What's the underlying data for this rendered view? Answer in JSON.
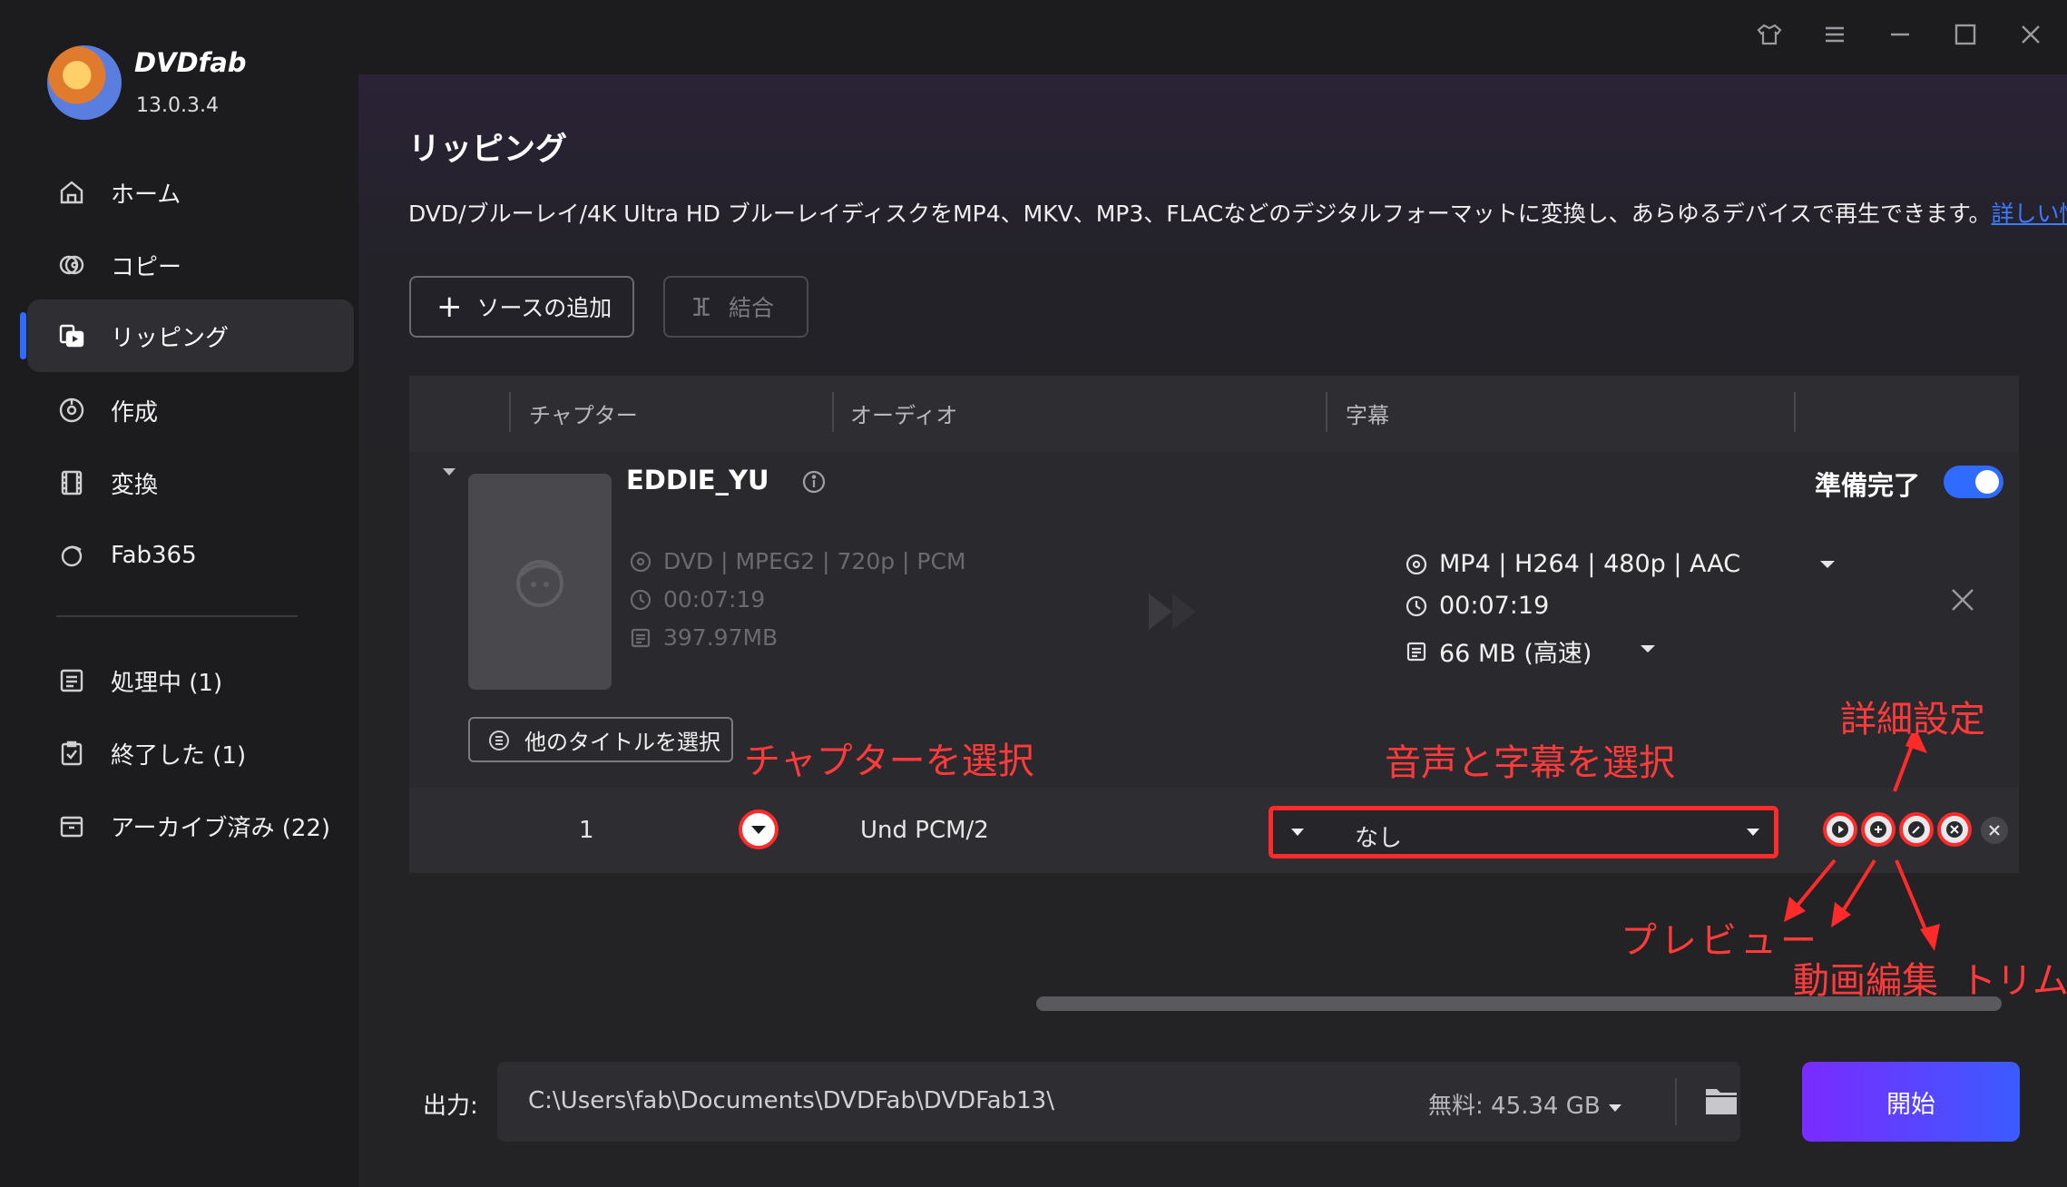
{
  "app": {
    "name": "DVDfab",
    "version": "13.0.3.4"
  },
  "sidebar": {
    "items": [
      {
        "label": "ホーム",
        "icon": "home-icon"
      },
      {
        "label": "コピー",
        "icon": "copy-icon"
      },
      {
        "label": "リッピング",
        "icon": "ripper-icon",
        "active": true
      },
      {
        "label": "作成",
        "icon": "creator-icon"
      },
      {
        "label": "変換",
        "icon": "converter-icon"
      },
      {
        "label": "Fab365",
        "icon": "fab365-icon"
      }
    ],
    "queue": [
      {
        "label": "処理中 (1)",
        "icon": "processing-icon"
      },
      {
        "label": "終了した (1)",
        "icon": "finished-icon"
      },
      {
        "label": "アーカイブ済み (22)",
        "icon": "archive-icon"
      }
    ]
  },
  "page": {
    "title": "リッピング",
    "description": "DVD/ブルーレイ/4K Ultra HD ブルーレイディスクをMP4、MKV、MP3、FLACなどのデジタルフォーマットに変換し、あらゆるデバイスで再生できます。",
    "more_link": "詳しい情報..."
  },
  "toolbar": {
    "add_source": "ソースの追加",
    "merge": "結合"
  },
  "table": {
    "columns": [
      "チャプター",
      "オーディオ",
      "字幕"
    ]
  },
  "title_item": {
    "name": "EDDIE_YU",
    "source": {
      "format": "DVD | MPEG2 | 720p | PCM",
      "duration": "00:07:19",
      "size": "397.97MB"
    },
    "output": {
      "format": "MP4 | H264 | 480p | AAC",
      "duration": "00:07:19",
      "size": "66 MB (高速)"
    },
    "ready_label": "準備完了",
    "ready": true,
    "other_titles_button": "他のタイトルを選択"
  },
  "chapter_row": {
    "chapter": "1",
    "audio": "Und  PCM/2",
    "subtitle": "なし"
  },
  "annotations": {
    "chapter": "チャプターを選択",
    "audio_subtitle": "音声と字幕を選択",
    "settings": "詳細設定",
    "preview": "プレビュー",
    "edit": "動画編集",
    "trim": "トリム"
  },
  "colors": {
    "accent": "#2f6bff",
    "annotation": "#ff2a2a",
    "start_gradient": [
      "#7a2bff",
      "#3b5bff"
    ]
  },
  "output": {
    "label": "出力:",
    "path": "C:\\Users\\fab\\Documents\\DVDFab\\DVDFab13\\",
    "free_space": "無料: 45.34 GB",
    "start": "開始"
  }
}
